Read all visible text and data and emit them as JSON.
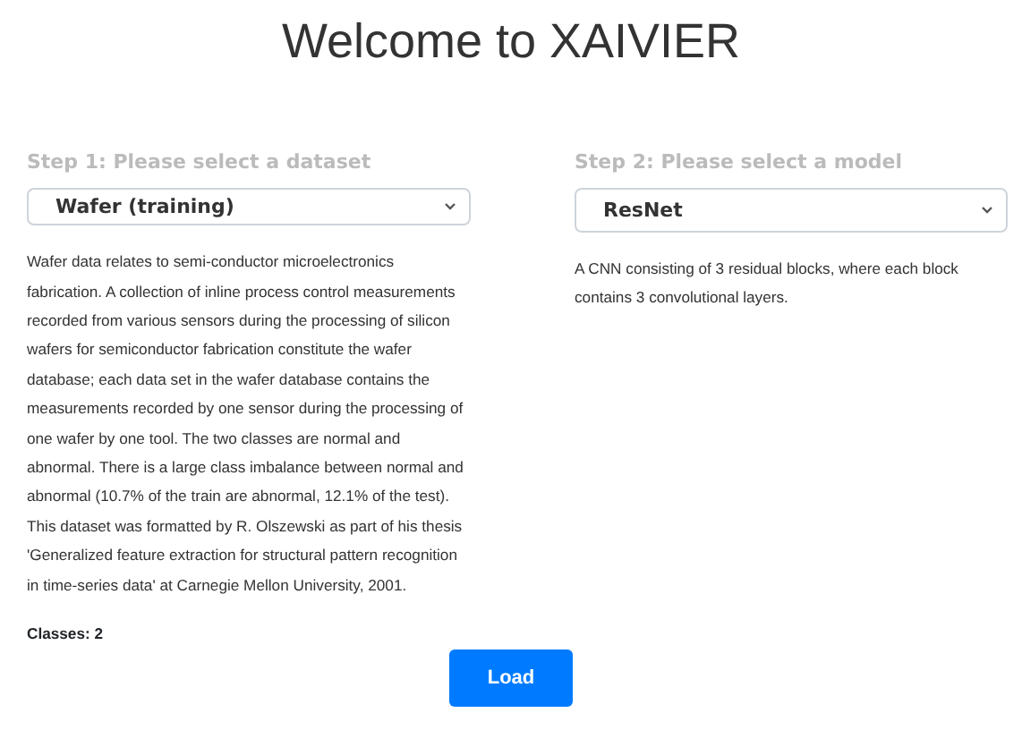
{
  "title": "Welcome to XAIVIER",
  "steps": [
    {
      "label": "Step 1: Please select a dataset",
      "value": "Wafer (training)",
      "description": "Wafer data relates to semi-conductor microelectronics fabrication. A collection of inline process control measurements recorded from various sensors during the processing of silicon wafers for semiconductor fabrication constitute the wafer database; each data set in the wafer database contains the measurements recorded by one sensor during the processing of one wafer by one tool. The two classes are normal and abnormal. There is a large class imbalance between normal and abnormal (10.7% of the train are abnormal, 12.1% of the test). This dataset was formatted by R. Olszewski as part of his thesis 'Generalized feature extraction for structural pattern recognition in time-series data' at Carnegie Mellon University, 2001.",
      "info": "Classes: 2"
    },
    {
      "label": "Step 2: Please select a model",
      "value": "ResNet",
      "description": "A CNN consisting of 3 residual blocks, where each block contains 3 convolutional layers."
    }
  ],
  "load_button": "Load"
}
